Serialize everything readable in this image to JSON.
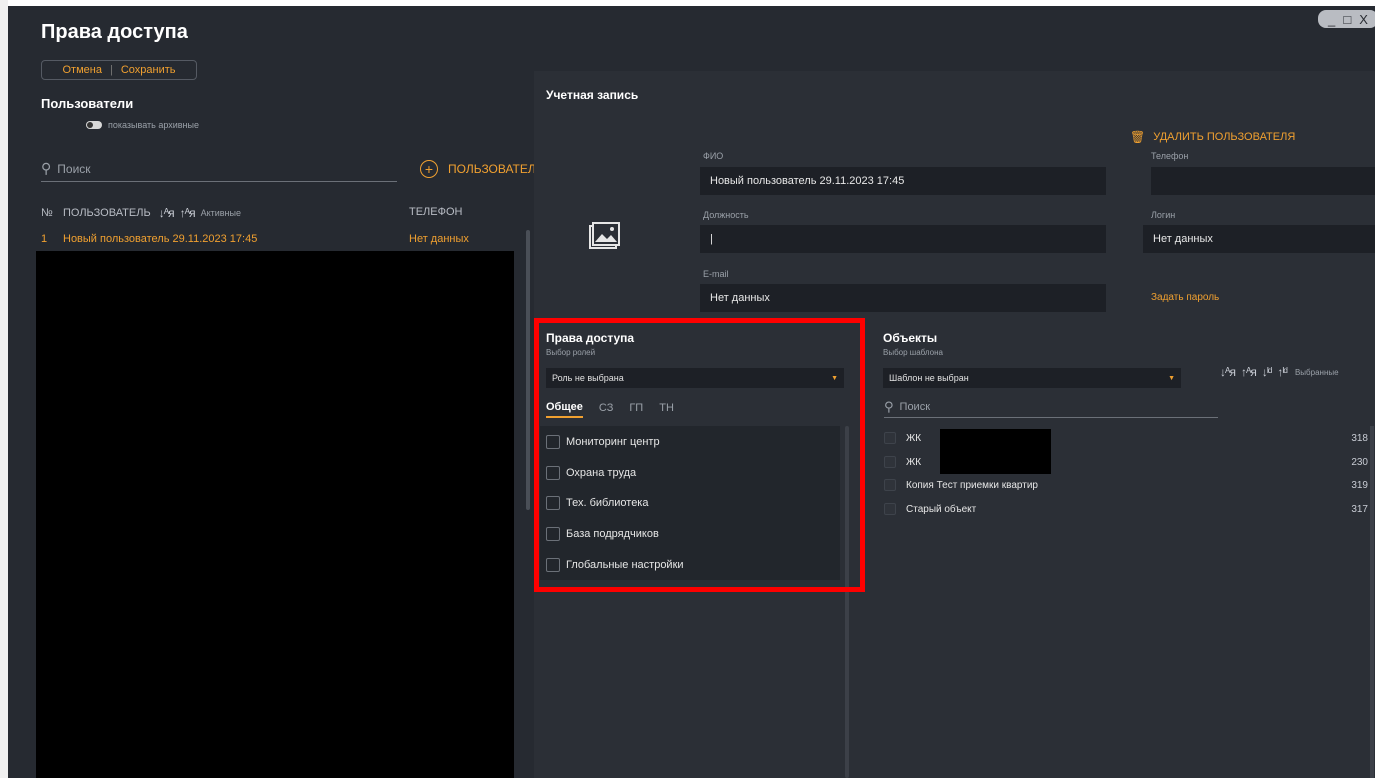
{
  "window": {
    "controls": [
      "_",
      "□",
      "X"
    ]
  },
  "page_title": "Права доступа",
  "toolbar": {
    "cancel_label": "Отмена",
    "save_label": "Сохранить"
  },
  "users": {
    "title": "Пользователи",
    "show_archived_label": "показывать архивные",
    "search_placeholder": "Поиск",
    "add_user_label": "ПОЛЬЗОВАТЕЛЬ",
    "columns": {
      "no": "№",
      "user": "ПОЛЬЗОВАТЕЛЬ",
      "active": "Активные",
      "phone": "ТЕЛЕФОН"
    },
    "rows": [
      {
        "no": "1",
        "name": "Новый пользователь 29.11.2023 17:45",
        "phone": "Нет данных"
      }
    ]
  },
  "account": {
    "title": "Учетная запись",
    "delete_user_label": "УДАЛИТЬ ПОЛЬЗОВАТЕЛЯ",
    "fio_label": "ФИО",
    "fio_value": "Новый пользователь 29.11.2023 17:45",
    "position_label": "Должность",
    "position_value": "|",
    "email_label": "E-mail",
    "email_value": "Нет данных",
    "phone_label": "Телефон",
    "phone_value": "",
    "login_label": "Логин",
    "login_value": "Нет данных",
    "set_password_label": "Задать пароль"
  },
  "access": {
    "title": "Права доступа",
    "subtitle": "Выбор ролей",
    "role_select": "Роль не выбрана",
    "tabs": [
      "Общее",
      "СЗ",
      "ГП",
      "ТН"
    ],
    "active_tab": "Общее",
    "permissions": [
      {
        "label": "Мониторинг центр",
        "checked": false
      },
      {
        "label": "Охрана труда",
        "checked": false
      },
      {
        "label": "Тех. библиотека",
        "checked": false
      },
      {
        "label": "База подрядчиков",
        "checked": false
      },
      {
        "label": "Глобальные настройки",
        "checked": false
      }
    ]
  },
  "objects": {
    "title": "Объекты",
    "subtitle": "Выбор шаблона",
    "template_select": "Шаблон не выбран",
    "selected_label": "Выбранные",
    "search_placeholder": "Поиск",
    "items": [
      {
        "name": "ЖК",
        "id": "318"
      },
      {
        "name": "ЖК",
        "id": "230"
      },
      {
        "name": "Копия Тест приемки квартир",
        "id": "319"
      },
      {
        "name": "Старый объект",
        "id": "317"
      }
    ]
  },
  "colors": {
    "accent": "#f0a030",
    "background": "#262a31",
    "panel": "#2b2f36",
    "highlight": "#ff0000"
  }
}
